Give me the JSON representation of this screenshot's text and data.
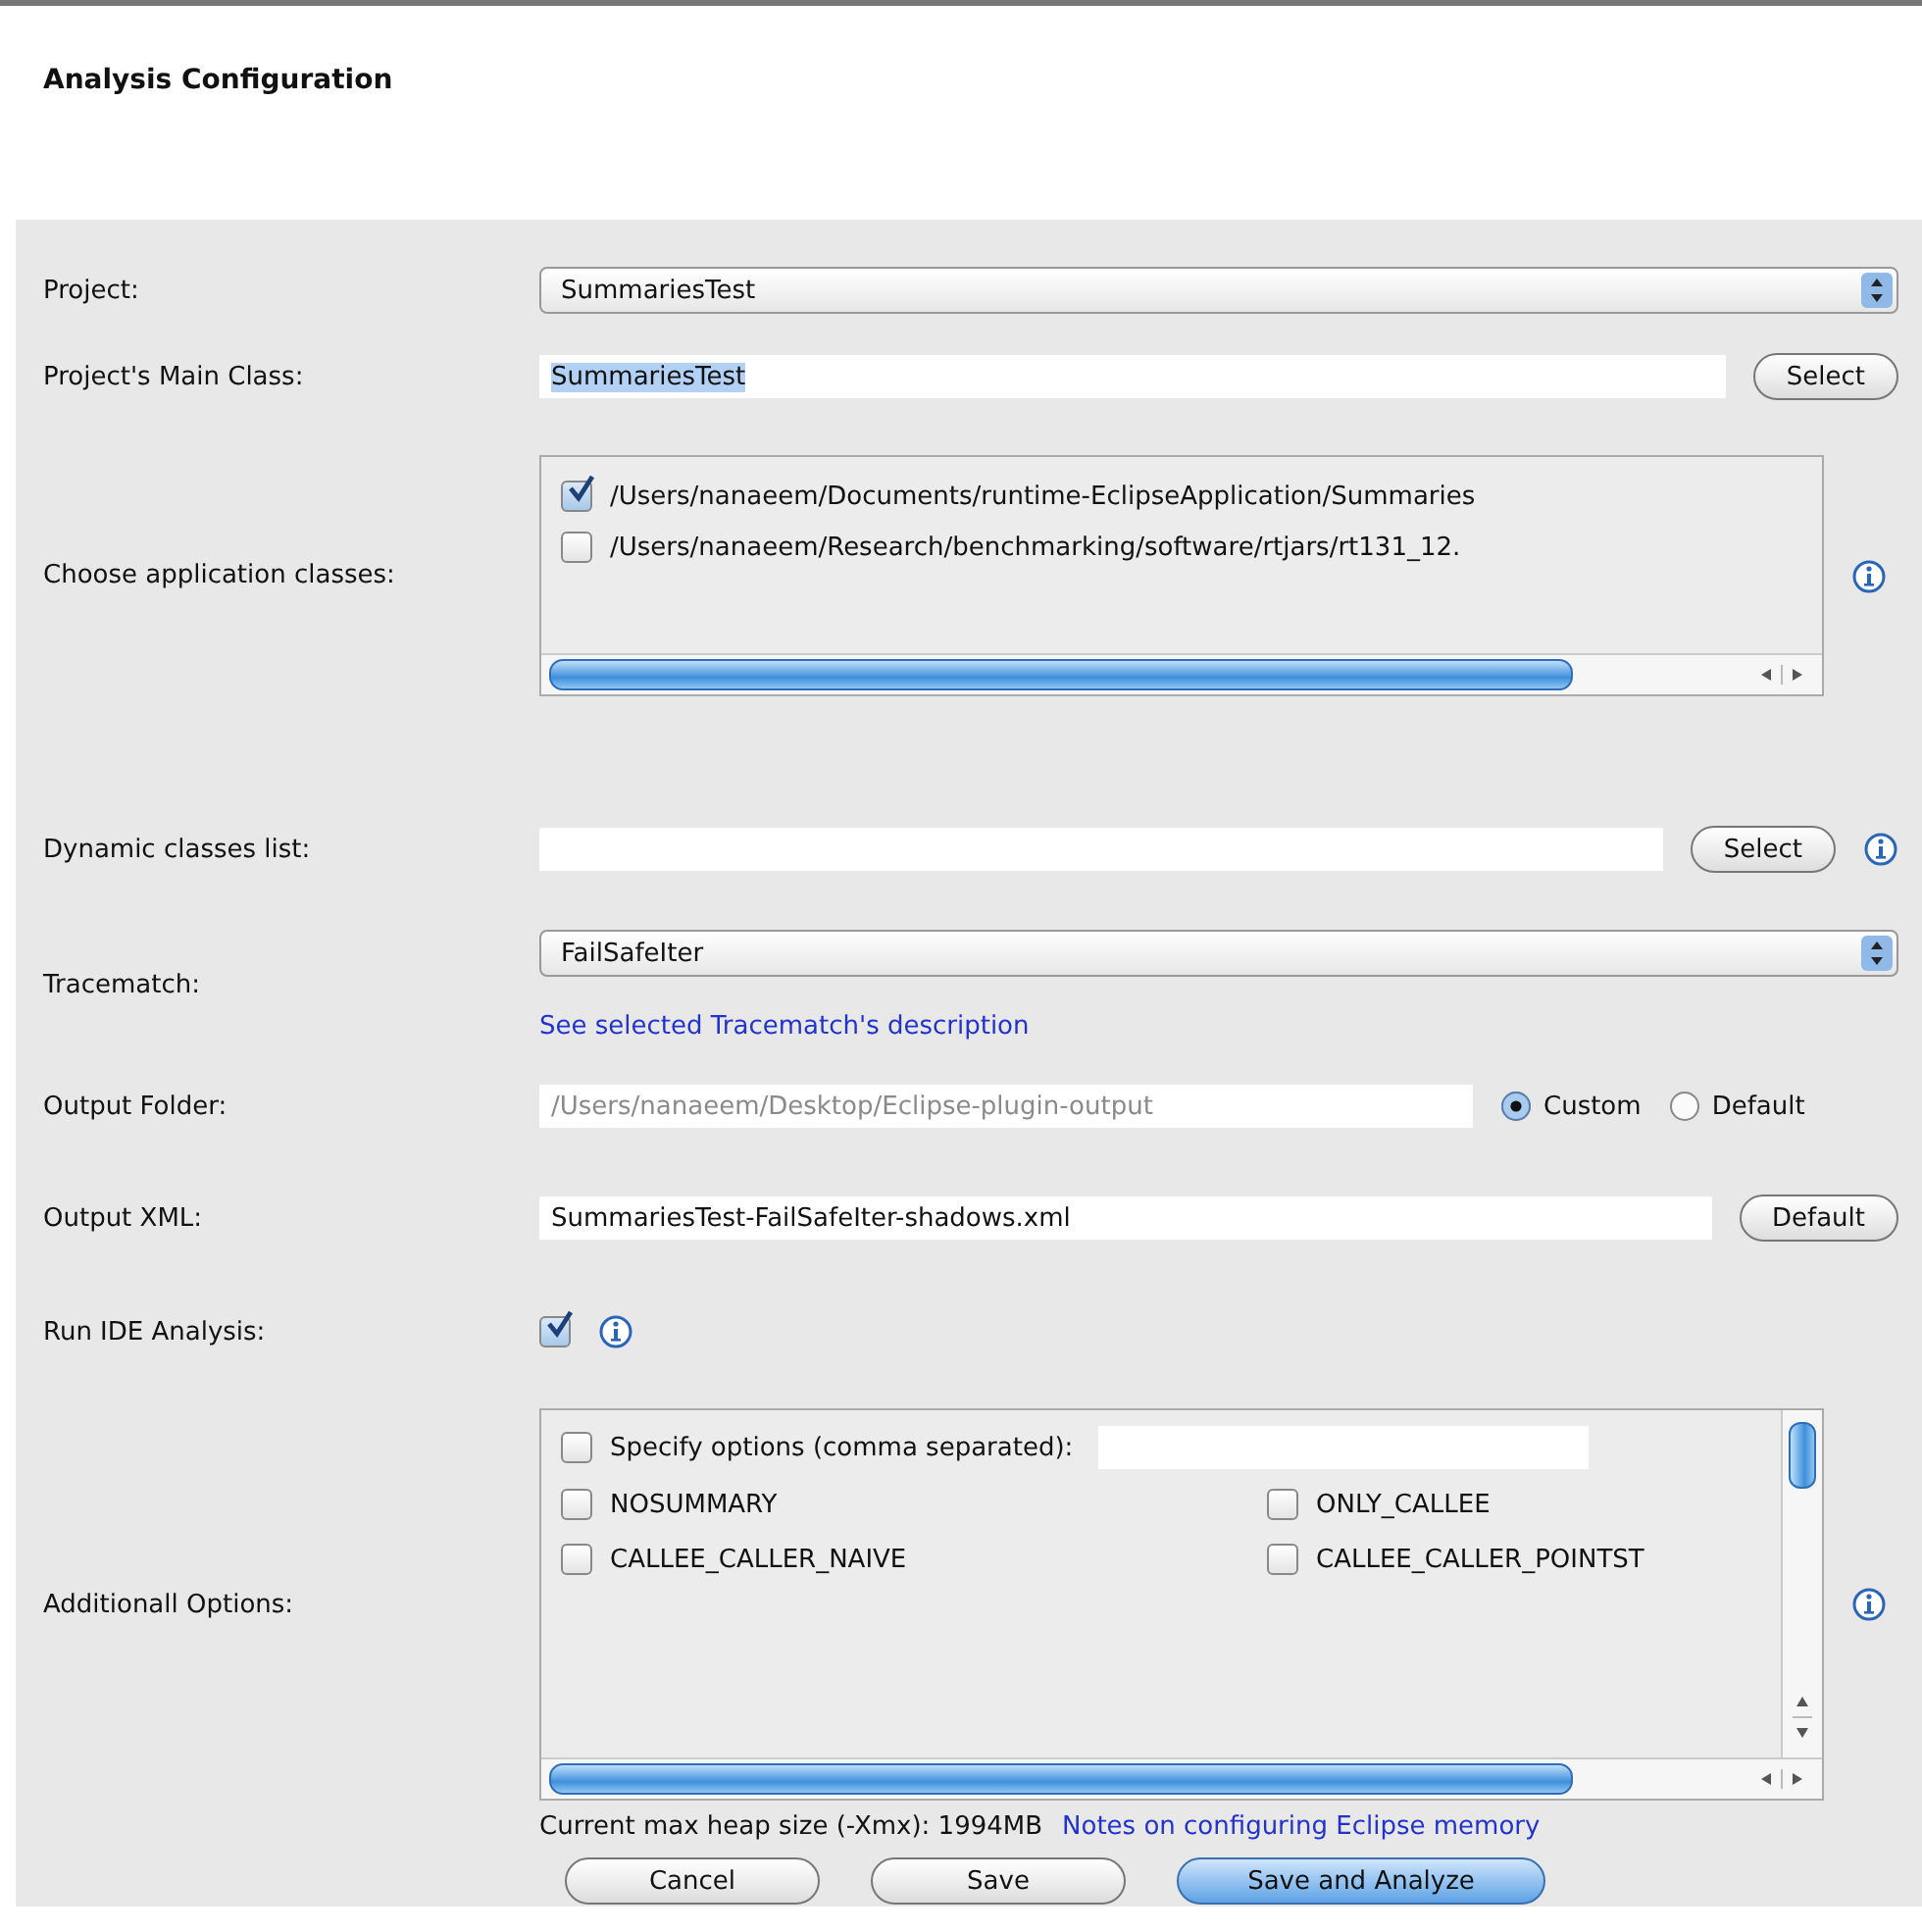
{
  "title": "Analysis Configuration",
  "rows": [
    {
      "kind": "dropdown",
      "label": "Project:",
      "value": "SummariesTest"
    },
    {
      "kind": "text",
      "label": "Project's Main Class:",
      "value": "SummariesTest",
      "highlighted": true,
      "button": "Select"
    },
    {
      "kind": "checklist",
      "label": "Choose application classes:",
      "info": true,
      "items": [
        {
          "text": "/Users/nanaeem/Documents/runtime-EclipseApplication/Summaries",
          "checked": true
        },
        {
          "text": "/Users/nanaeem/Research/benchmarking/software/rtjars/rt131_12.",
          "checked": false
        }
      ]
    },
    {
      "kind": "text",
      "label": "Dynamic classes list:",
      "button": "Select",
      "info": true
    },
    {
      "kind": "dropdown",
      "label": "Tracematch:",
      "value": "FailSafeIter",
      "link": "See selected Tracematch's description"
    },
    {
      "kind": "folder",
      "label": "Output Folder:",
      "value": "/Users/nanaeem/Desktop/Eclipse-plugin-output",
      "disabled": true,
      "radios": [
        {
          "label": "Custom",
          "selected": true
        },
        {
          "label": "Default",
          "selected": false
        }
      ]
    },
    {
      "kind": "text",
      "label": "Output XML:",
      "value": "SummariesTest-FailSafeIter-shadows.xml",
      "button": "Default"
    },
    {
      "kind": "checkbox",
      "label": "Run IDE Analysis:",
      "checked": true,
      "info": true
    },
    {
      "kind": "options",
      "label": "Additionall Options:",
      "info": true,
      "specify": {
        "label": "Specify options (comma separated):",
        "checked": false
      },
      "options": [
        {
          "text": "NOSUMMARY",
          "checked": false
        },
        {
          "text": "ONLY_CALLEE",
          "checked": false
        },
        {
          "text": "CALLEE_CALLER_NAIVE",
          "checked": false
        },
        {
          "text": "CALLEE_CALLER_POINTST",
          "checked": false
        }
      ]
    }
  ],
  "heap": {
    "text": "Current max heap size (-Xmx): 1994MB",
    "link": "Notes on configuring Eclipse memory"
  },
  "buttons": [
    {
      "label": "Cancel",
      "default": false
    },
    {
      "label": "Save",
      "default": false
    },
    {
      "label": "Save and Analyze",
      "default": true
    }
  ]
}
